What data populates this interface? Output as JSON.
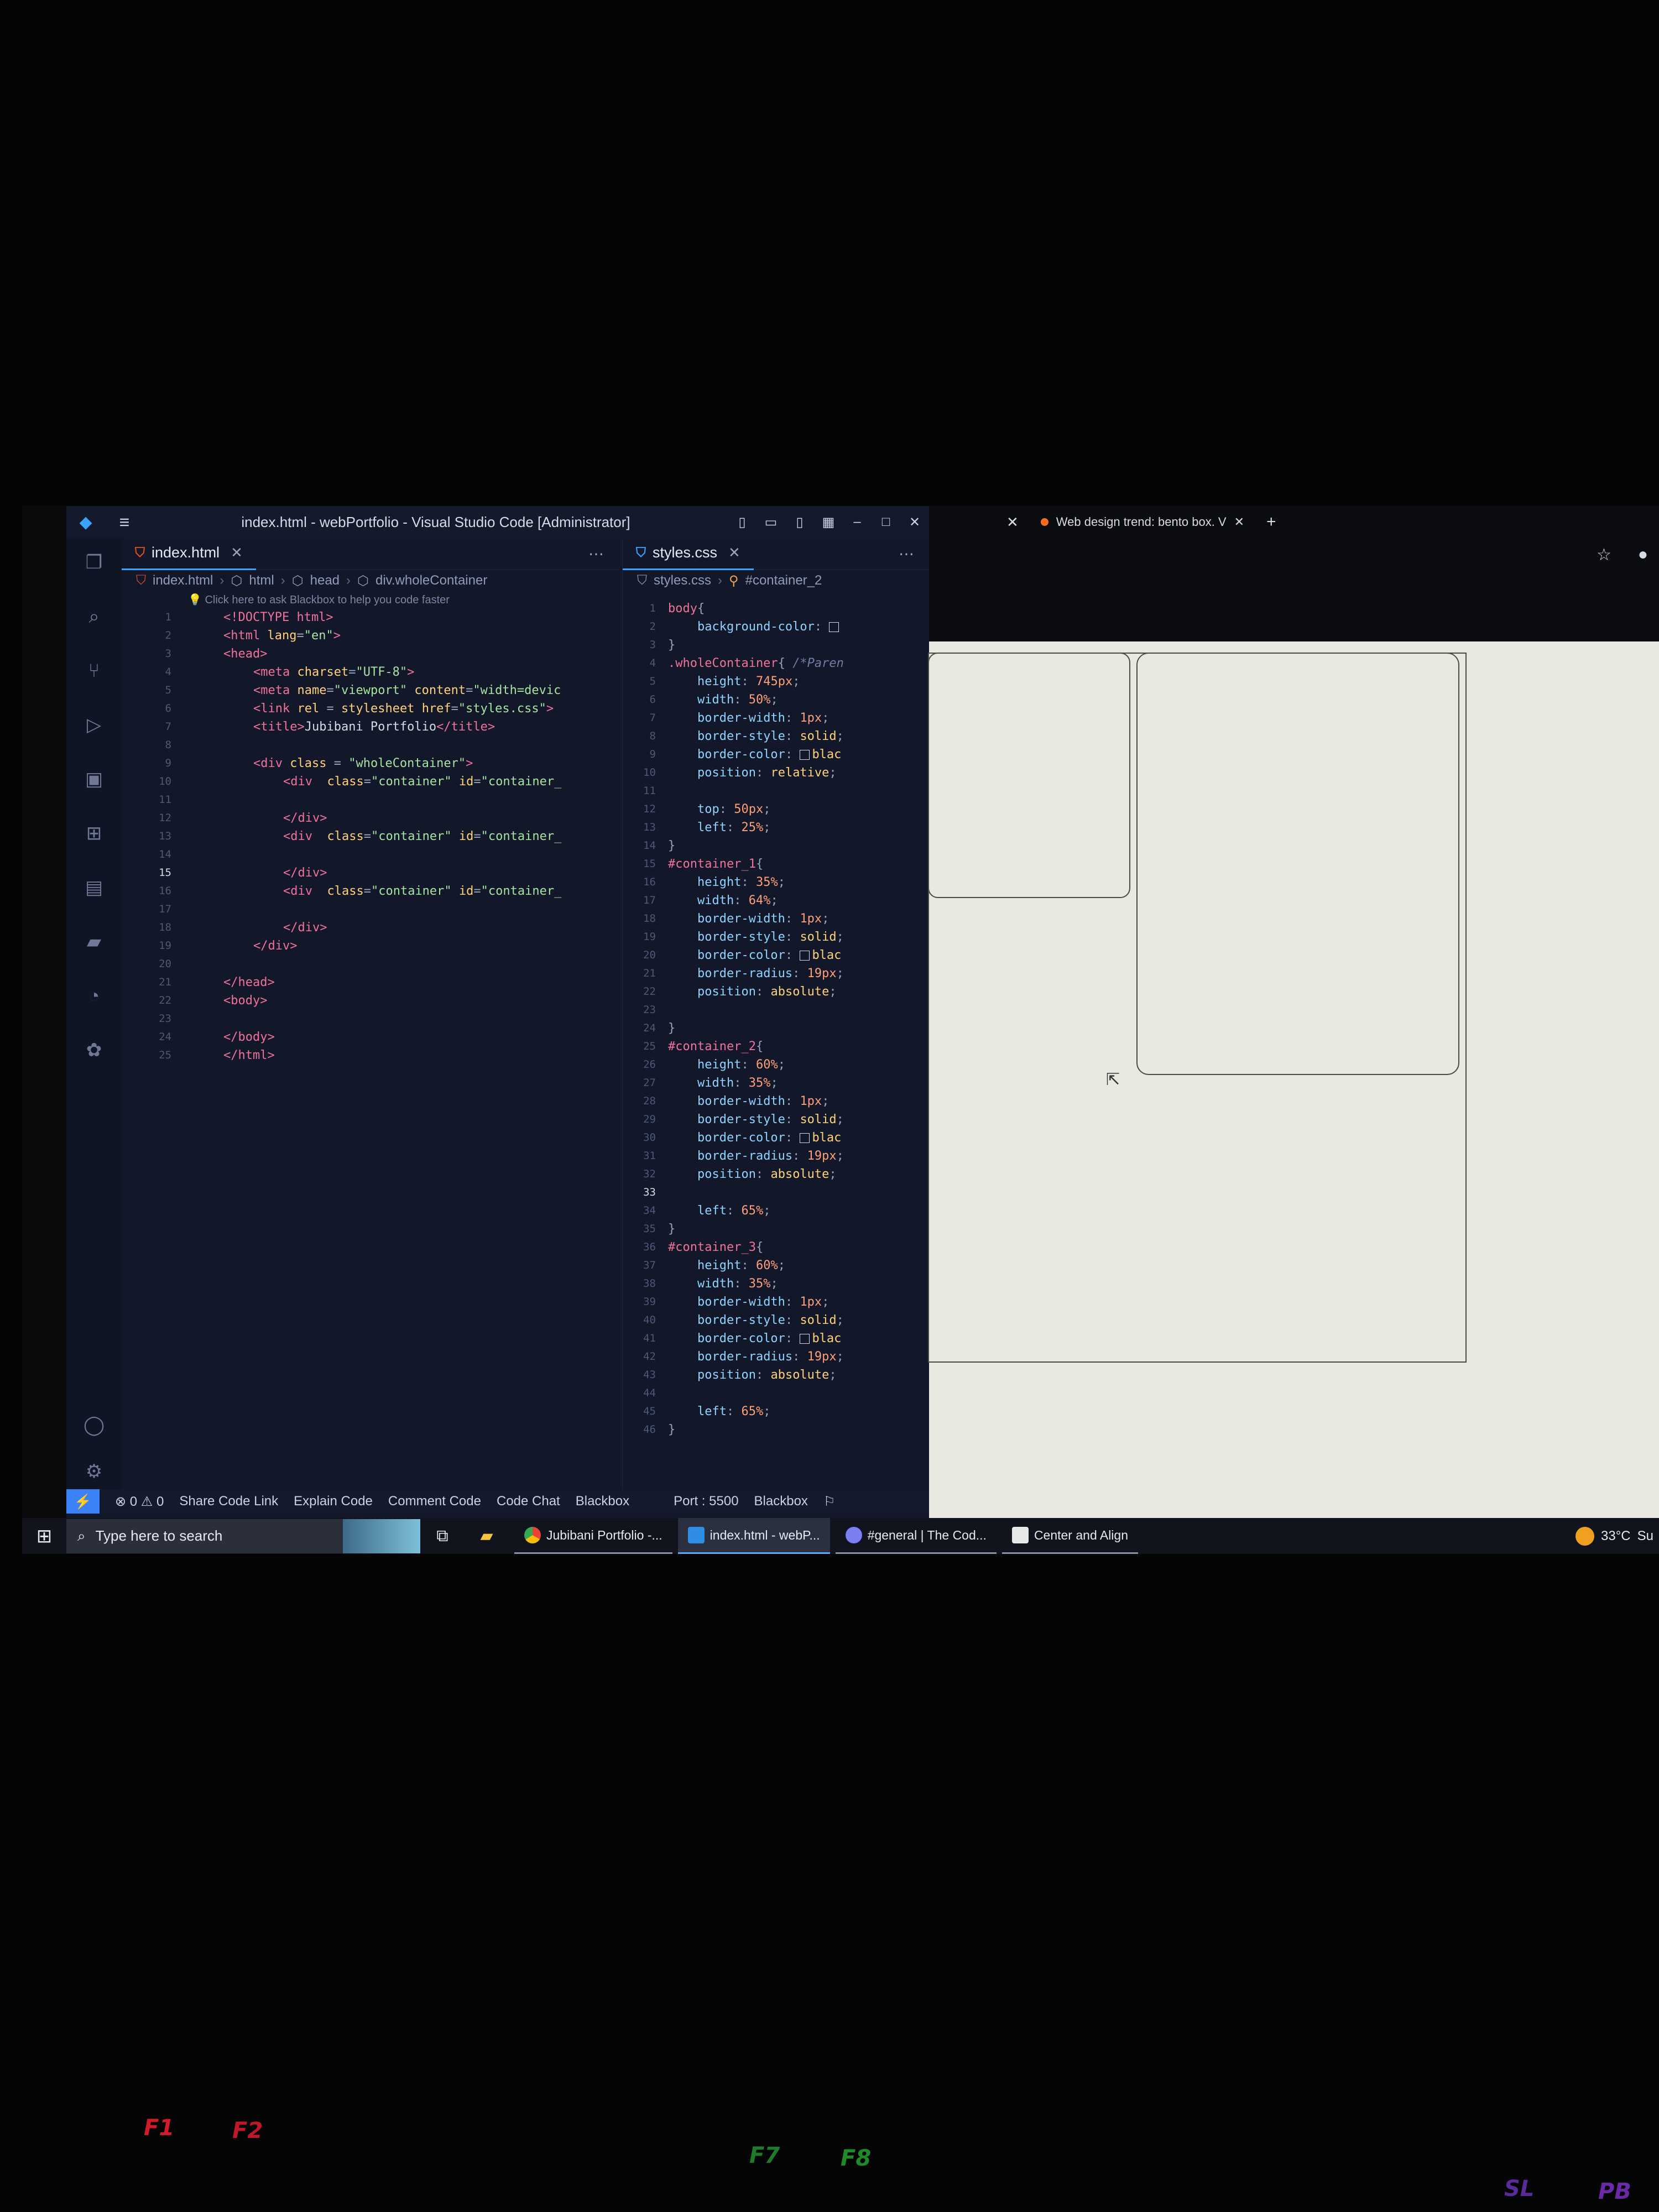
{
  "window": {
    "title": "index.html - webPortfolio - Visual Studio Code [Administrator]",
    "menu_icon": "hamburger-icon"
  },
  "editor1": {
    "tab_label": "index.html",
    "breadcrumb": [
      "index.html",
      "html",
      "head",
      "div.wholeContainer"
    ],
    "hint": "Click here to ask Blackbox to help you code faster",
    "lines": [
      {
        "n": "1",
        "html": "<span class='tg'>&lt;!DOCTYPE html&gt;</span>",
        "indent": 1
      },
      {
        "n": "2",
        "html": "<span class='tg'>&lt;html</span> <span class='at'>lang</span><span class='pu'>=</span><span class='st'>\"en\"</span><span class='tg'>&gt;</span>",
        "indent": 1
      },
      {
        "n": "3",
        "html": "<span class='tg'>&lt;head&gt;</span>",
        "indent": 1
      },
      {
        "n": "4",
        "html": "<span class='tg'>&lt;meta</span> <span class='at'>charset</span><span class='pu'>=</span><span class='st'>\"UTF-8\"</span><span class='tg'>&gt;</span>",
        "indent": 2
      },
      {
        "n": "5",
        "html": "<span class='tg'>&lt;meta</span> <span class='at'>name</span><span class='pu'>=</span><span class='st'>\"viewport\"</span> <span class='at'>content</span><span class='pu'>=</span><span class='st'>\"width=devic</span>",
        "indent": 2
      },
      {
        "n": "6",
        "html": "<span class='tg'>&lt;link</span> <span class='at'>rel</span> <span class='pu'>=</span> <span class='at'>stylesheet</span> <span class='at'>href</span><span class='pu'>=</span><span class='st'>\"styles.css\"</span><span class='tg'>&gt;</span>",
        "indent": 2
      },
      {
        "n": "7",
        "html": "<span class='tg'>&lt;title&gt;</span><span class='tx'>Jubibani Portfolio</span><span class='tg'>&lt;/title&gt;</span>",
        "indent": 2
      },
      {
        "n": "8",
        "html": "",
        "indent": 0
      },
      {
        "n": "9",
        "html": "<span class='tg'>&lt;div</span> <span class='at'>class</span> <span class='pu'>=</span> <span class='st'>\"wholeContainer\"</span><span class='tg'>&gt;</span>",
        "indent": 2
      },
      {
        "n": "10",
        "html": "<span class='tg'>&lt;div</span>  <span class='at'>class</span><span class='pu'>=</span><span class='st'>\"container\"</span> <span class='at'>id</span><span class='pu'>=</span><span class='st'>\"container_</span>",
        "indent": 3
      },
      {
        "n": "11",
        "html": "",
        "indent": 0
      },
      {
        "n": "12",
        "html": "<span class='tg'>&lt;/div&gt;</span>",
        "indent": 3
      },
      {
        "n": "13",
        "html": "<span class='tg'>&lt;div</span>  <span class='at'>class</span><span class='pu'>=</span><span class='st'>\"container\"</span> <span class='at'>id</span><span class='pu'>=</span><span class='st'>\"container_</span>",
        "indent": 3
      },
      {
        "n": "14",
        "html": "",
        "indent": 0
      },
      {
        "n": "15",
        "html": "<span class='tg'>&lt;/div&gt;</span>",
        "indent": 3,
        "cur": true
      },
      {
        "n": "16",
        "html": "<span class='tg'>&lt;div</span>  <span class='at'>class</span><span class='pu'>=</span><span class='st'>\"container\"</span> <span class='at'>id</span><span class='pu'>=</span><span class='st'>\"container_</span>",
        "indent": 3
      },
      {
        "n": "17",
        "html": "",
        "indent": 0
      },
      {
        "n": "18",
        "html": "<span class='tg'>&lt;/div&gt;</span>",
        "indent": 3
      },
      {
        "n": "19",
        "html": "<span class='tg'>&lt;/div&gt;</span>",
        "indent": 2
      },
      {
        "n": "20",
        "html": "",
        "indent": 0
      },
      {
        "n": "21",
        "html": "<span class='tg'>&lt;/head&gt;</span>",
        "indent": 1
      },
      {
        "n": "22",
        "html": "<span class='tg'>&lt;body&gt;</span>",
        "indent": 1
      },
      {
        "n": "23",
        "html": "",
        "indent": 0
      },
      {
        "n": "24",
        "html": "<span class='tg'>&lt;/body&gt;</span>",
        "indent": 1
      },
      {
        "n": "25",
        "html": "<span class='tg'>&lt;/html&gt;</span>",
        "indent": 1
      }
    ]
  },
  "editor2": {
    "tab_label": "styles.css",
    "breadcrumb": [
      "styles.css",
      "#container_2"
    ],
    "lines": [
      {
        "n": "1",
        "html": "<span class='sel'>body</span><span class='pu'>{</span>"
      },
      {
        "n": "2",
        "html": "    <span class='prop'>background-color</span><span class='pu'>:</span> <span class='sw'></span>"
      },
      {
        "n": "3",
        "html": "<span class='pu'>}</span>"
      },
      {
        "n": "4",
        "html": "<span class='sel'>.wholeContainer</span><span class='pu'>{</span> <span class='cm'>/*Paren</span>"
      },
      {
        "n": "5",
        "html": "    <span class='prop'>height</span><span class='pu'>:</span> <span class='num'>745px</span><span class='pu'>;</span>"
      },
      {
        "n": "6",
        "html": "    <span class='prop'>width</span><span class='pu'>:</span> <span class='num'>50%</span><span class='pu'>;</span>"
      },
      {
        "n": "7",
        "html": "    <span class='prop'>border-width</span><span class='pu'>:</span> <span class='num'>1px</span><span class='pu'>;</span>"
      },
      {
        "n": "8",
        "html": "    <span class='prop'>border-style</span><span class='pu'>:</span> <span class='val'>solid</span><span class='pu'>;</span>"
      },
      {
        "n": "9",
        "html": "    <span class='prop'>border-color</span><span class='pu'>:</span> <span class='sw'></span><span class='val'>blac</span>"
      },
      {
        "n": "10",
        "html": "    <span class='prop'>position</span><span class='pu'>:</span> <span class='val'>relative</span><span class='pu'>;</span>"
      },
      {
        "n": "11",
        "html": ""
      },
      {
        "n": "12",
        "html": "    <span class='prop'>top</span><span class='pu'>:</span> <span class='num'>50px</span><span class='pu'>;</span>"
      },
      {
        "n": "13",
        "html": "    <span class='prop'>left</span><span class='pu'>:</span> <span class='num'>25%</span><span class='pu'>;</span>"
      },
      {
        "n": "14",
        "html": "<span class='pu'>}</span>"
      },
      {
        "n": "15",
        "html": "<span class='sel'>#container_1</span><span class='pu'>{</span>"
      },
      {
        "n": "16",
        "html": "    <span class='prop'>height</span><span class='pu'>:</span> <span class='num'>35%</span><span class='pu'>;</span>"
      },
      {
        "n": "17",
        "html": "    <span class='prop'>width</span><span class='pu'>:</span> <span class='num'>64%</span><span class='pu'>;</span>"
      },
      {
        "n": "18",
        "html": "    <span class='prop'>border-width</span><span class='pu'>:</span> <span class='num'>1px</span><span class='pu'>;</span>"
      },
      {
        "n": "19",
        "html": "    <span class='prop'>border-style</span><span class='pu'>:</span> <span class='val'>solid</span><span class='pu'>;</span>"
      },
      {
        "n": "20",
        "html": "    <span class='prop'>border-color</span><span class='pu'>:</span> <span class='sw'></span><span class='val'>blac</span>"
      },
      {
        "n": "21",
        "html": "    <span class='prop'>border-radius</span><span class='pu'>:</span> <span class='num'>19px</span><span class='pu'>;</span>"
      },
      {
        "n": "22",
        "html": "    <span class='prop'>position</span><span class='pu'>:</span> <span class='val'>absolute</span><span class='pu'>;</span>"
      },
      {
        "n": "23",
        "html": ""
      },
      {
        "n": "24",
        "html": "<span class='pu'>}</span>"
      },
      {
        "n": "25",
        "html": "<span class='sel'>#container_2</span><span class='pu'>{</span>"
      },
      {
        "n": "26",
        "html": "    <span class='prop'>height</span><span class='pu'>:</span> <span class='num'>60%</span><span class='pu'>;</span>"
      },
      {
        "n": "27",
        "html": "    <span class='prop'>width</span><span class='pu'>:</span> <span class='num'>35%</span><span class='pu'>;</span>"
      },
      {
        "n": "28",
        "html": "    <span class='prop'>border-width</span><span class='pu'>:</span> <span class='num'>1px</span><span class='pu'>;</span>"
      },
      {
        "n": "29",
        "html": "    <span class='prop'>border-style</span><span class='pu'>:</span> <span class='val'>solid</span><span class='pu'>;</span>"
      },
      {
        "n": "30",
        "html": "    <span class='prop'>border-color</span><span class='pu'>:</span> <span class='sw'></span><span class='val'>blac</span>"
      },
      {
        "n": "31",
        "html": "    <span class='prop'>border-radius</span><span class='pu'>:</span> <span class='num'>19px</span><span class='pu'>;</span>"
      },
      {
        "n": "32",
        "html": "    <span class='prop'>position</span><span class='pu'>:</span> <span class='val'>absolute</span><span class='pu'>;</span>"
      },
      {
        "n": "33",
        "html": "",
        "cur": true
      },
      {
        "n": "34",
        "html": "    <span class='prop'>left</span><span class='pu'>:</span> <span class='num'>65%</span><span class='pu'>;</span>"
      },
      {
        "n": "35",
        "html": "<span class='pu'>}</span>"
      },
      {
        "n": "36",
        "html": "<span class='sel'>#container_3</span><span class='pu'>{</span>"
      },
      {
        "n": "37",
        "html": "    <span class='prop'>height</span><span class='pu'>:</span> <span class='num'>60%</span><span class='pu'>;</span>"
      },
      {
        "n": "38",
        "html": "    <span class='prop'>width</span><span class='pu'>:</span> <span class='num'>35%</span><span class='pu'>;</span>"
      },
      {
        "n": "39",
        "html": "    <span class='prop'>border-width</span><span class='pu'>:</span> <span class='num'>1px</span><span class='pu'>;</span>"
      },
      {
        "n": "40",
        "html": "    <span class='prop'>border-style</span><span class='pu'>:</span> <span class='val'>solid</span><span class='pu'>;</span>"
      },
      {
        "n": "41",
        "html": "    <span class='prop'>border-color</span><span class='pu'>:</span> <span class='sw'></span><span class='val'>blac</span>"
      },
      {
        "n": "42",
        "html": "    <span class='prop'>border-radius</span><span class='pu'>:</span> <span class='num'>19px</span><span class='pu'>;</span>"
      },
      {
        "n": "43",
        "html": "    <span class='prop'>position</span><span class='pu'>:</span> <span class='val'>absolute</span><span class='pu'>;</span>"
      },
      {
        "n": "44",
        "html": ""
      },
      {
        "n": "45",
        "html": "    <span class='prop'>left</span><span class='pu'>:</span> <span class='num'>65%</span><span class='pu'>;</span>"
      },
      {
        "n": "46",
        "html": "<span class='pu'>}</span>"
      }
    ]
  },
  "statusbar": {
    "problems": "0",
    "warnings": "0",
    "items": [
      "Share Code Link",
      "Explain Code",
      "Comment Code",
      "Code Chat",
      "Blackbox"
    ],
    "port": "Port : 5500",
    "blackbox": "Blackbox"
  },
  "browser": {
    "tab_title": "Web design trend: bento box. V",
    "tab_color": "#ff6b1a"
  },
  "taskbar": {
    "search_placeholder": "Type here to search",
    "apps": [
      "Jubibani Portfolio -...",
      "index.html - webP...",
      "#general | The Cod...",
      "Center and Align"
    ],
    "temperature": "33°C",
    "weather_trail": "Su"
  },
  "keyboard": {
    "keys": [
      "F1",
      "F2",
      "F7",
      "F8",
      "SL",
      "PB"
    ]
  }
}
